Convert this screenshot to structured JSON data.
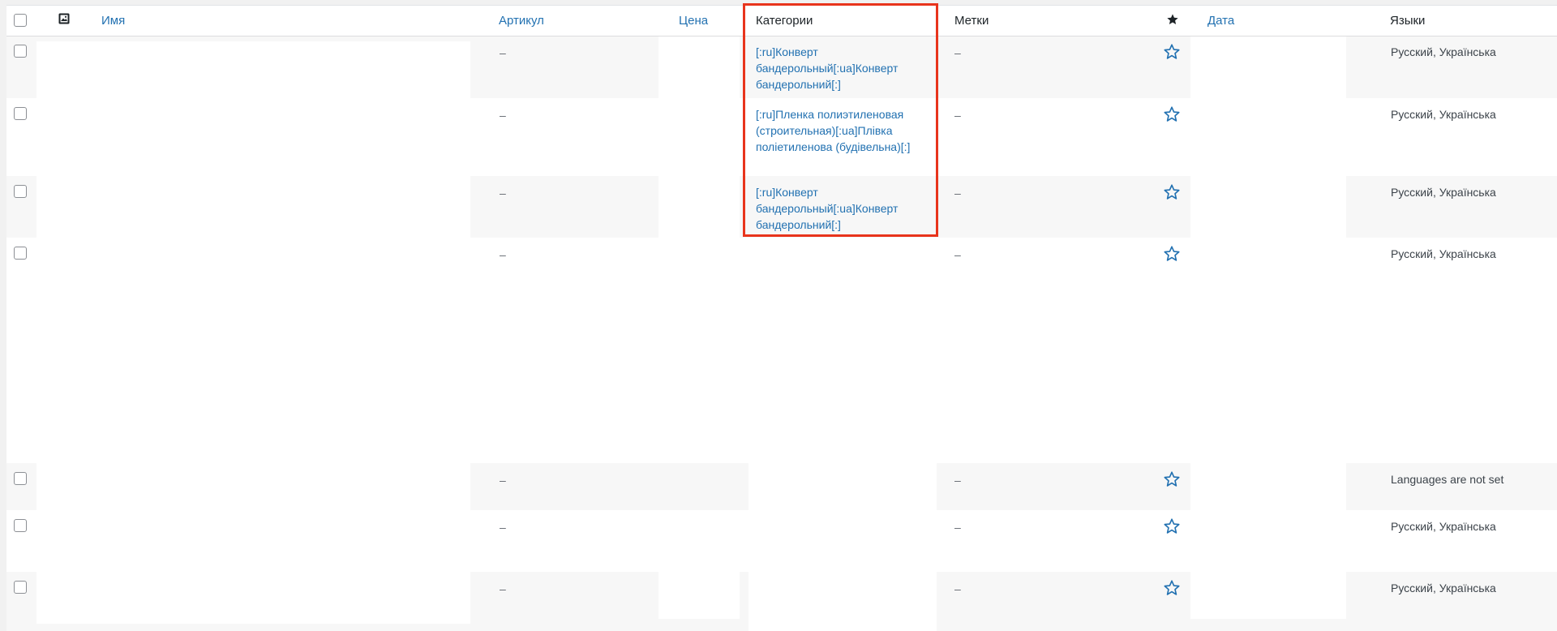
{
  "header": {
    "image_col_icon": "image-icon",
    "name": "Имя",
    "sku": "Артикул",
    "price": "Цена",
    "categories": "Категории",
    "tags": "Метки",
    "featured_icon": "star-filled-icon",
    "date": "Дата",
    "languages": "Языки"
  },
  "rows": [
    {
      "sku": "–",
      "category": "[:ru]Конверт бандерольный[:ua]Конверт бандерольний[:]",
      "tags": "–",
      "languages": "Русский, Українська"
    },
    {
      "sku": "–",
      "category": "[:ru]Пленка полиэтиленовая (строительная)[:ua]Плівка поліетиленова (будівельна)[:]",
      "tags": "–",
      "languages": "Русский, Українська"
    },
    {
      "sku": "–",
      "category": "[:ru]Конверт бандерольный[:ua]Конверт бандерольний[:]",
      "tags": "–",
      "languages": "Русский, Українська"
    },
    {
      "sku": "–",
      "category": "",
      "tags": "–",
      "languages": "Русский, Українська"
    },
    {
      "sku": "–",
      "category": "",
      "tags": "–",
      "languages": "Languages are not set"
    },
    {
      "sku": "–",
      "category": "",
      "tags": "–",
      "languages": "Русский, Українська"
    },
    {
      "sku": "–",
      "category": "",
      "tags": "–",
      "languages": "Русский, Українська"
    }
  ],
  "colors": {
    "link": "#2271b1",
    "highlight": "#e8341c",
    "alt_row": "#f7f7f7"
  }
}
